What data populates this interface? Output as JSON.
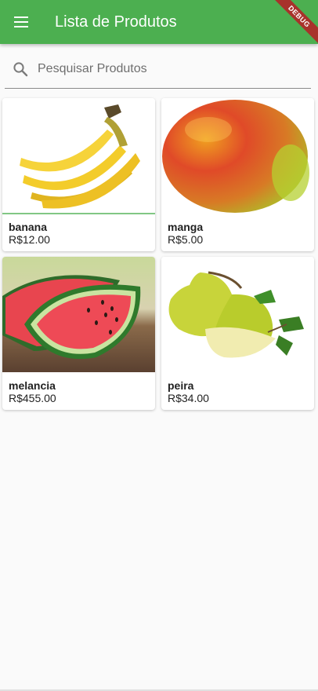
{
  "appbar": {
    "title": "Lista de Produtos",
    "menu_icon": "menu-icon",
    "color": "#4caf50",
    "debug_label": "DEBUG"
  },
  "search": {
    "placeholder": "Pesquisar Produtos",
    "value": "",
    "icon": "search-icon"
  },
  "products": [
    {
      "name": "banana",
      "price": "R$12.00",
      "image": "banana-image"
    },
    {
      "name": "manga",
      "price": "R$5.00",
      "image": "mango-image"
    },
    {
      "name": "melancia",
      "price": "R$455.00",
      "image": "watermelon-image"
    },
    {
      "name": "peira",
      "price": "R$34.00",
      "image": "pear-image"
    }
  ]
}
